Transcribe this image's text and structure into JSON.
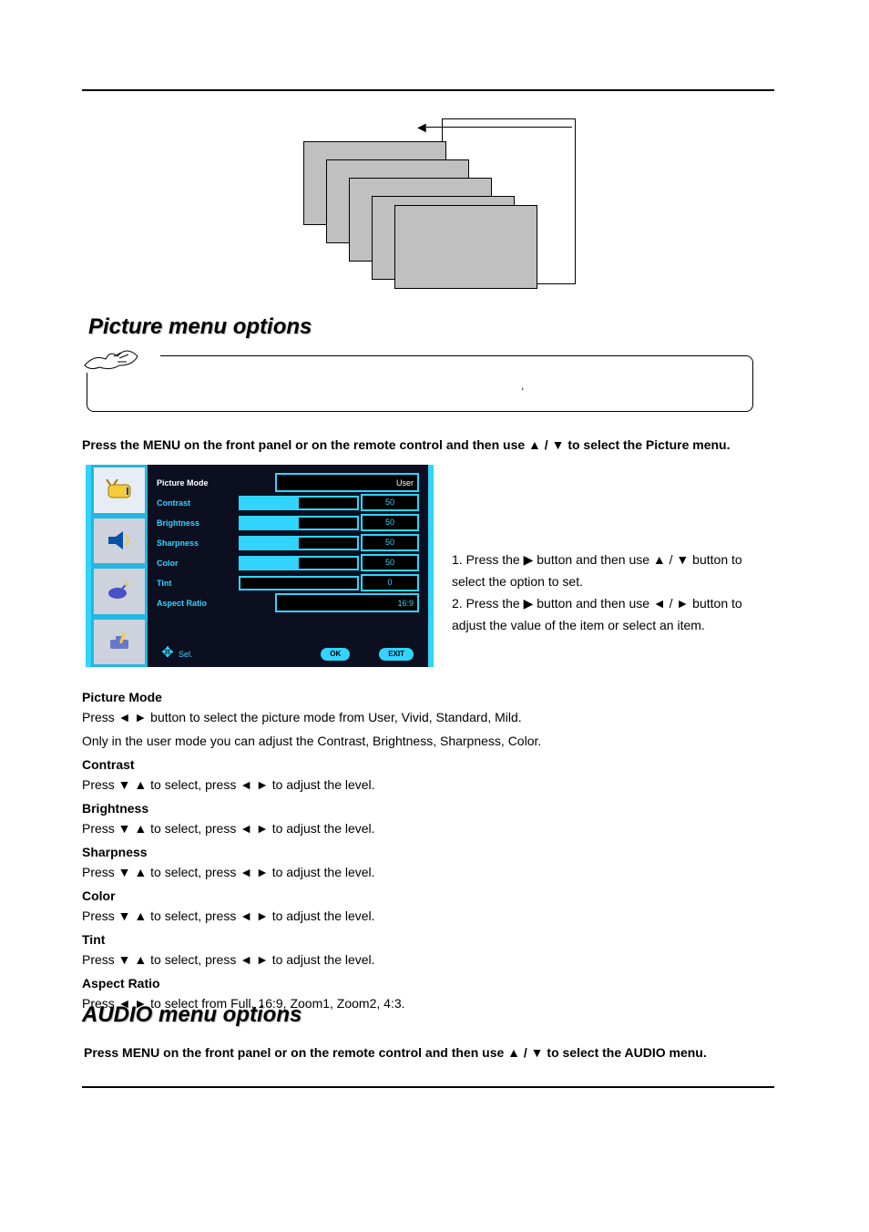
{
  "headings": {
    "picture_menu": "Picture menu options",
    "audio_menu": "AUDIO menu options"
  },
  "note_box_text": ",",
  "instructions": {
    "picture_press": "Press the MENU on the front panel or on the remote control and then use  ▲ / ▼   to select the Picture menu.",
    "audio_press": "Press MENU on the front panel or on the remote control and then use ▲ / ▼ to select the AUDIO menu."
  },
  "osd": {
    "items": [
      {
        "label": "Picture Mode",
        "type": "select",
        "value": "User",
        "selected": true
      },
      {
        "label": "Contrast",
        "type": "slider",
        "value": 50
      },
      {
        "label": "Brightness",
        "type": "slider",
        "value": 50
      },
      {
        "label": "Sharpness",
        "type": "slider",
        "value": 50
      },
      {
        "label": "Color",
        "type": "slider",
        "value": 50
      },
      {
        "label": "Tint",
        "type": "slider",
        "value": 0
      },
      {
        "label": "Aspect Ratio",
        "type": "select",
        "value": "16:9"
      }
    ],
    "bottom": {
      "sel": "Sel.",
      "bt1": "OK",
      "bt2": "EXIT"
    }
  },
  "side_steps": {
    "s1a": "1. Press the ▶ button and then use ▲ / ▼ button to",
    "s1b": "select the option to set.",
    "s2a": "2. Press the ▶ button and then use ◄  /  ► button to",
    "s2b": "adjust the value of the item or select an item."
  },
  "options": {
    "picture_mode": {
      "title": "Picture Mode",
      "desc": "Press ◄ ► button to select the picture mode from User, Vivid, Standard, Mild.",
      "note": "Only in the user mode you can adjust the Contrast, Brightness, Sharpness, Color."
    },
    "contrast": {
      "title": "Contrast",
      "desc": "Press ▼ ▲ to select, press ◄ ► to adjust the level."
    },
    "brightness": {
      "title": "Brightness",
      "desc": "Press ▼ ▲ to select, press ◄ ► to adjust the level."
    },
    "sharpness": {
      "title": "Sharpness",
      "desc": "Press ▼ ▲ to select, press ◄ ► to adjust the level."
    },
    "color": {
      "title": "Color",
      "desc": "Press ▼ ▲ to select, press ◄ ► to adjust the level."
    },
    "tint": {
      "title": "Tint",
      "desc": "Press ▼ ▲ to select, press ◄ ► to adjust the level."
    },
    "aspect_ratio": {
      "title": "Aspect Ratio",
      "desc": "Press ◄ ► to select from Full, 16:9, Zoom1, Zoom2, 4:3."
    }
  }
}
